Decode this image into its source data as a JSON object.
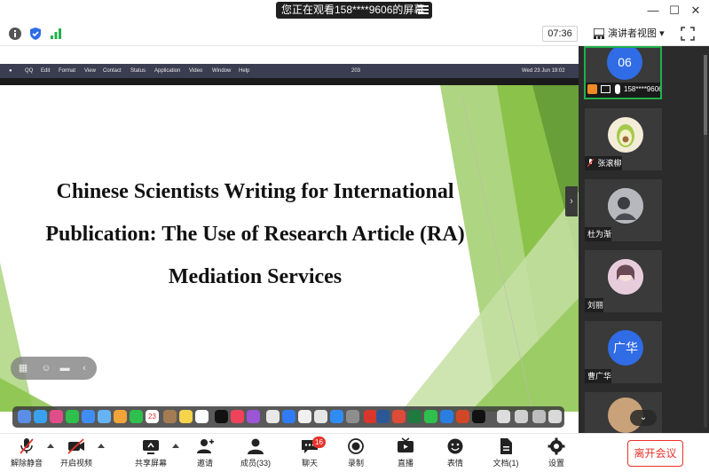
{
  "window": {
    "share_banner": "您正在观看158****9606的屏幕",
    "controls": {
      "minimize": "—",
      "maximize": "☐",
      "close": "✕"
    }
  },
  "toolbar": {
    "time": "07:36",
    "view_label": "演讲者视图",
    "view_caret": "▾"
  },
  "screen_share": {
    "mac_menu": [
      "QQ",
      "Edit",
      "Format",
      "View",
      "Contact",
      "Status",
      "Application",
      "Video",
      "Window",
      "Help"
    ],
    "mac_clock": "Wed 23 Jun  19:02",
    "mac_battery": "203",
    "slide_title": "Chinese Scientists Writing for International Publication: The Use of Research Article (RA) Mediation Services",
    "dock_badge": "23"
  },
  "participants": [
    {
      "name": "158****9606的屏幕",
      "avatar_text": "06",
      "avatar_color": "#2f6ce5",
      "active": true
    },
    {
      "name": "张滚柳",
      "avatar_text": "",
      "avatar_color": "#f3ecd9",
      "active": false
    },
    {
      "name": "杜为渐",
      "avatar_text": "",
      "avatar_color": "#c9c9cf",
      "active": false
    },
    {
      "name": "刘丽",
      "avatar_text": "",
      "avatar_color": "#e9d3df",
      "active": false
    },
    {
      "name": "曹广华",
      "avatar_text": "广华",
      "avatar_color": "#2f6ce5",
      "active": false
    }
  ],
  "bottom_toolbar": {
    "items": [
      {
        "id": "unmute",
        "label": "解除静音"
      },
      {
        "id": "video",
        "label": "开启视频"
      },
      {
        "id": "share",
        "label": "共享屏幕"
      },
      {
        "id": "invite",
        "label": "邀请"
      },
      {
        "id": "members",
        "label": "成员(33)"
      },
      {
        "id": "chat",
        "label": "聊天",
        "badge": "16"
      },
      {
        "id": "record",
        "label": "录制"
      },
      {
        "id": "live",
        "label": "直播"
      },
      {
        "id": "reaction",
        "label": "表情"
      },
      {
        "id": "docs",
        "label": "文档(1)"
      },
      {
        "id": "settings",
        "label": "设置"
      }
    ],
    "leave_label": "离开会议"
  },
  "colors": {
    "accent_green": "#21b04b",
    "danger_red": "#e7332b",
    "avatar_blue": "#2f6ce5"
  }
}
